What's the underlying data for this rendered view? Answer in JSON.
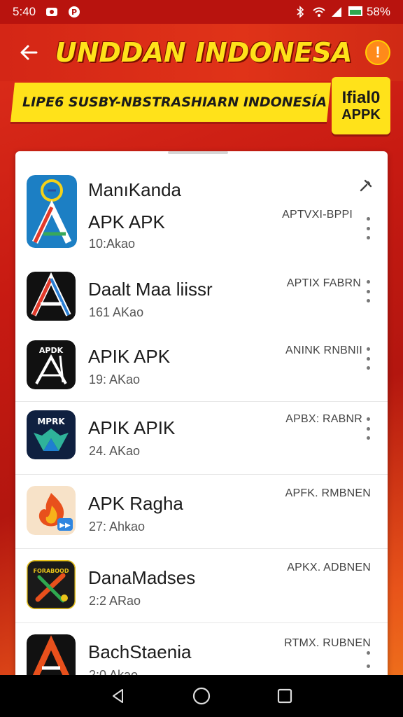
{
  "status": {
    "time": "5:40",
    "battery": "58%"
  },
  "header": {
    "title": "UNDDAN INDONESA",
    "banner": "LIPE6 SUSBY-NBSTRASHIARN INDONESÍA",
    "badge_line1": "Ifial0",
    "badge_line2": "APPK"
  },
  "apps": [
    {
      "name": "ManıKanda",
      "subtitle": "APK APK",
      "size": "10:Akao",
      "tag": "APTVXI-BPPI",
      "icon": "blue-a-logo-icon"
    },
    {
      "name": "Daalt Maa liissr",
      "size": "161 AKao",
      "tag": "APTIX FABRN",
      "icon": "black-a-logo-icon"
    },
    {
      "name": "APIK APK",
      "size": "19: AKao",
      "tag": "ANINK RNBNII",
      "icon": "apdk-logo-icon"
    },
    {
      "name": "APIK APIK",
      "size": "24. AKao",
      "tag": "APBX: RABNR",
      "icon": "mprk-logo-icon"
    },
    {
      "name": "APK Ragha",
      "size": "27: Ahkao",
      "tag": "APFK. RMBNEN",
      "icon": "flame-logo-icon"
    },
    {
      "name": "DanaMadses",
      "size": "2:2 ARao",
      "tag": "APKX. ADBNEN",
      "icon": "tools-logo-icon"
    },
    {
      "name": "BachStaenia",
      "size": "2:0 Akao",
      "tag": "RTMX. RUBNEN",
      "icon": "red-a-logo-icon"
    }
  ],
  "colors": {
    "accent": "#ffe21a",
    "header_red": "#d42616"
  }
}
